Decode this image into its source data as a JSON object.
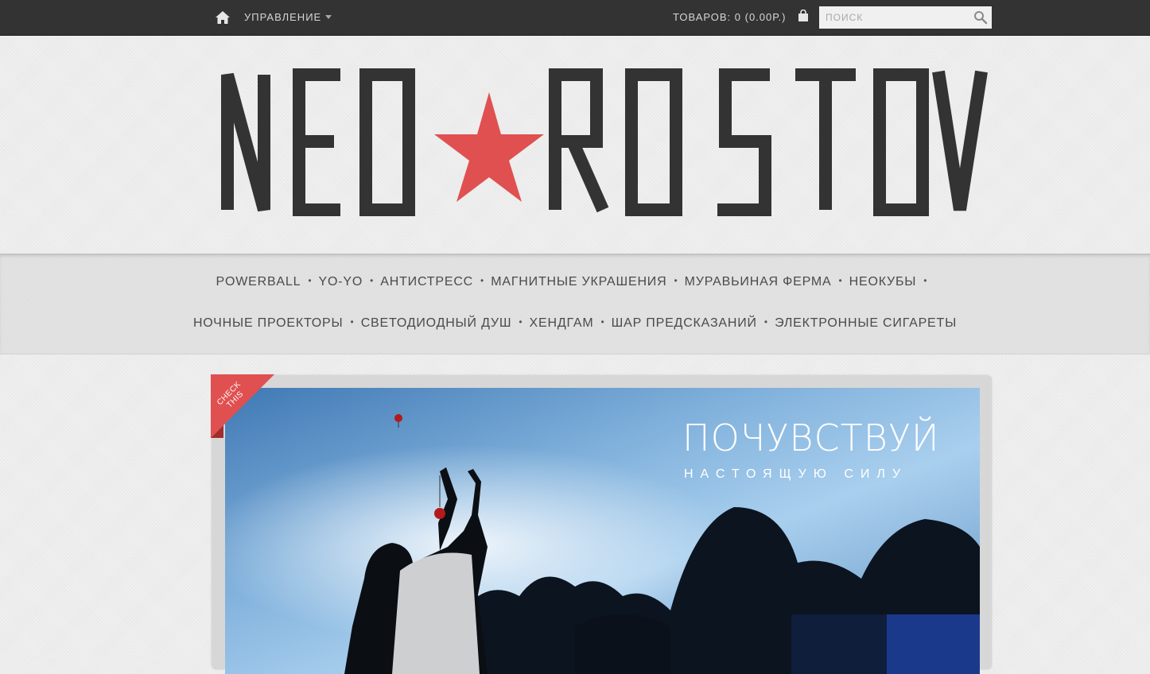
{
  "topbar": {
    "manage_label": "УПРАВЛЕНИЕ",
    "cart_label": "ТОВАРОВ: 0 (0.00Р.)",
    "search_placeholder": "ПОИСК"
  },
  "logo": {
    "left": "NEO",
    "right": "ROSTOV",
    "star_color": "#e05050",
    "text_color": "#333333"
  },
  "nav": {
    "row1": [
      "POWERBALL",
      "YO-YO",
      "АНТИСТРЕСС",
      "МАГНИТНЫЕ УКРАШЕНИЯ",
      "МУРАВЬИНАЯ ФЕРМА",
      "НЕОКУБЫ"
    ],
    "row2": [
      "НОЧНЫЕ ПРОЕКТОРЫ",
      "СВЕТОДИОДНЫЙ ДУШ",
      "ХЕНДГАМ",
      "ШАР ПРЕДСКАЗАНИЙ",
      "ЭЛЕКТРОННЫЕ СИГАРЕТЫ"
    ],
    "separator": "•"
  },
  "slide": {
    "ribbon_line1": "CHECK",
    "ribbon_line2": "THIS",
    "headline": "ПОЧУВСТВУЙ",
    "subline": "НАСТОЯЩУЮ СИЛУ",
    "ribbon_color": "#e05050"
  }
}
